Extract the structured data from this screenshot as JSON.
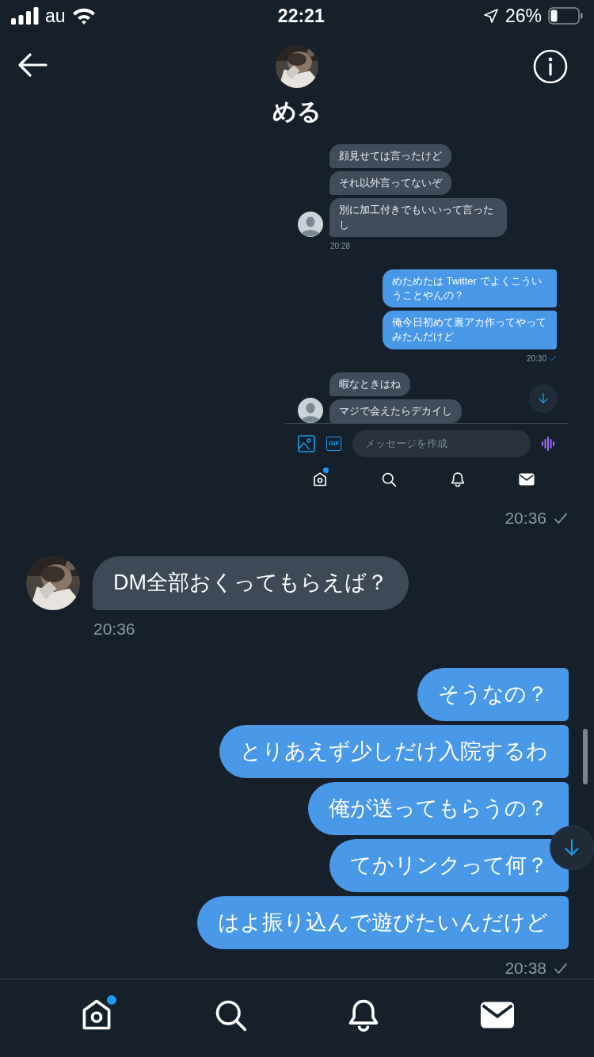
{
  "status_bar": {
    "carrier": "au",
    "time": "22:21",
    "battery": "26%"
  },
  "header": {
    "name": "める"
  },
  "conversation": [
    {
      "kind": "screenshot",
      "time": "20:36",
      "screenshot": {
        "groups": [
          {
            "kind": "incoming",
            "messages": [
              "顔見せては言ったけど",
              "それ以外言ってないぞ",
              "別に加工付きでもいいって言ったし"
            ],
            "time": "20:28"
          },
          {
            "kind": "outgoing",
            "messages": [
              "めためたは Twitter でよくこういうことやんの？",
              "俺今日初めて裏アカ作ってやってみたんだけど"
            ],
            "time": "20:30"
          },
          {
            "kind": "incoming",
            "messages": [
              "暇なときはね",
              "マジで会えたらデカイし"
            ]
          }
        ],
        "composer": {
          "placeholder": "メッセージを作成",
          "gif_label": "GIF"
        },
        "tabs": [
          {
            "kind": "home",
            "selected": false,
            "badge": true
          },
          {
            "kind": "search",
            "selected": false,
            "badge": false
          },
          {
            "kind": "bell",
            "selected": false,
            "badge": false
          },
          {
            "kind": "mail",
            "selected": true,
            "badge": false
          }
        ]
      }
    },
    {
      "kind": "incoming",
      "messages": [
        "DM全部おくってもらえば？"
      ],
      "time": "20:36"
    },
    {
      "kind": "outgoing",
      "messages": [
        "そうなの？",
        "とりあえず少しだけ入院するわ",
        "俺が送ってもらうの？",
        "てかリンクって何？",
        "はよ振り込んで遊びたいんだけど"
      ],
      "time": "20:38"
    }
  ],
  "tab_bar": {
    "tabs": [
      {
        "kind": "home",
        "selected": false,
        "badge": true
      },
      {
        "kind": "search",
        "selected": false,
        "badge": false
      },
      {
        "kind": "bell",
        "selected": false,
        "badge": false
      },
      {
        "kind": "mail",
        "selected": true,
        "badge": false
      }
    ]
  }
}
